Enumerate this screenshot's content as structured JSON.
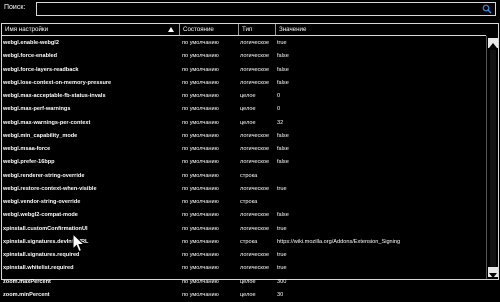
{
  "search": {
    "label": "Поиск:",
    "value": "",
    "placeholder": ""
  },
  "table": {
    "columns": [
      "Имя настройки",
      "Состояние",
      "Тип",
      "Значение"
    ],
    "rows": [
      {
        "name": "webgl.enable-webgl2",
        "state": "по умолчанию",
        "type": "логическое",
        "value": "true"
      },
      {
        "name": "webgl.force-enabled",
        "state": "по умолчанию",
        "type": "логическое",
        "value": "false"
      },
      {
        "name": "webgl.force-layers-readback",
        "state": "по умолчанию",
        "type": "логическое",
        "value": "false"
      },
      {
        "name": "webgl.lose-context-on-memory-pressure",
        "state": "по умолчанию",
        "type": "логическое",
        "value": "false"
      },
      {
        "name": "webgl.max-acceptable-fb-status-invals",
        "state": "по умолчанию",
        "type": "целое",
        "value": "0"
      },
      {
        "name": "webgl.max-perf-warnings",
        "state": "по умолчанию",
        "type": "целое",
        "value": "0"
      },
      {
        "name": "webgl.max-warnings-per-context",
        "state": "по умолчанию",
        "type": "целое",
        "value": "32"
      },
      {
        "name": "webgl.min_capability_mode",
        "state": "по умолчанию",
        "type": "логическое",
        "value": "false"
      },
      {
        "name": "webgl.msaa-force",
        "state": "по умолчанию",
        "type": "логическое",
        "value": "false"
      },
      {
        "name": "webgl.prefer-16bpp",
        "state": "по умолчанию",
        "type": "логическое",
        "value": "false"
      },
      {
        "name": "webgl.renderer-string-override",
        "state": "по умолчанию",
        "type": "строка",
        "value": ""
      },
      {
        "name": "webgl.restore-context-when-visible",
        "state": "по умолчанию",
        "type": "логическое",
        "value": "true"
      },
      {
        "name": "webgl.vendor-string-override",
        "state": "по умолчанию",
        "type": "строка",
        "value": ""
      },
      {
        "name": "webgl.webgl2-compat-mode",
        "state": "по умолчанию",
        "type": "логическое",
        "value": "false"
      },
      {
        "name": "xpinstall.customConfirmationUI",
        "state": "по умолчанию",
        "type": "логическое",
        "value": "true"
      },
      {
        "name": "xpinstall.signatures.devInfoURL",
        "state": "по умолчанию",
        "type": "строка",
        "value": "https://wiki.mozilla.org/Addons/Extension_Signing"
      },
      {
        "name": "xpinstall.signatures.required",
        "state": "по умолчанию",
        "type": "логическое",
        "value": "true"
      },
      {
        "name": "xpinstall.whitelist.required",
        "state": "по умолчанию",
        "type": "логическое",
        "value": "true"
      },
      {
        "name": "zoom.maxPercent",
        "state": "по умолчанию",
        "type": "целое",
        "value": "300"
      },
      {
        "name": "zoom.minPercent",
        "state": "по умолчанию",
        "type": "целое",
        "value": "30"
      }
    ]
  },
  "icons": {
    "search": "search-icon",
    "sort": "sort-ascending-icon",
    "cursor": "mouse-pointer-icon",
    "scroll_up": "chevron-up-icon",
    "scroll_down": "chevron-down-icon"
  },
  "colors": {
    "background": "#000000",
    "text": "#ffffff",
    "border": "#d8d8d8",
    "search_icon": "#3a8ee6"
  }
}
